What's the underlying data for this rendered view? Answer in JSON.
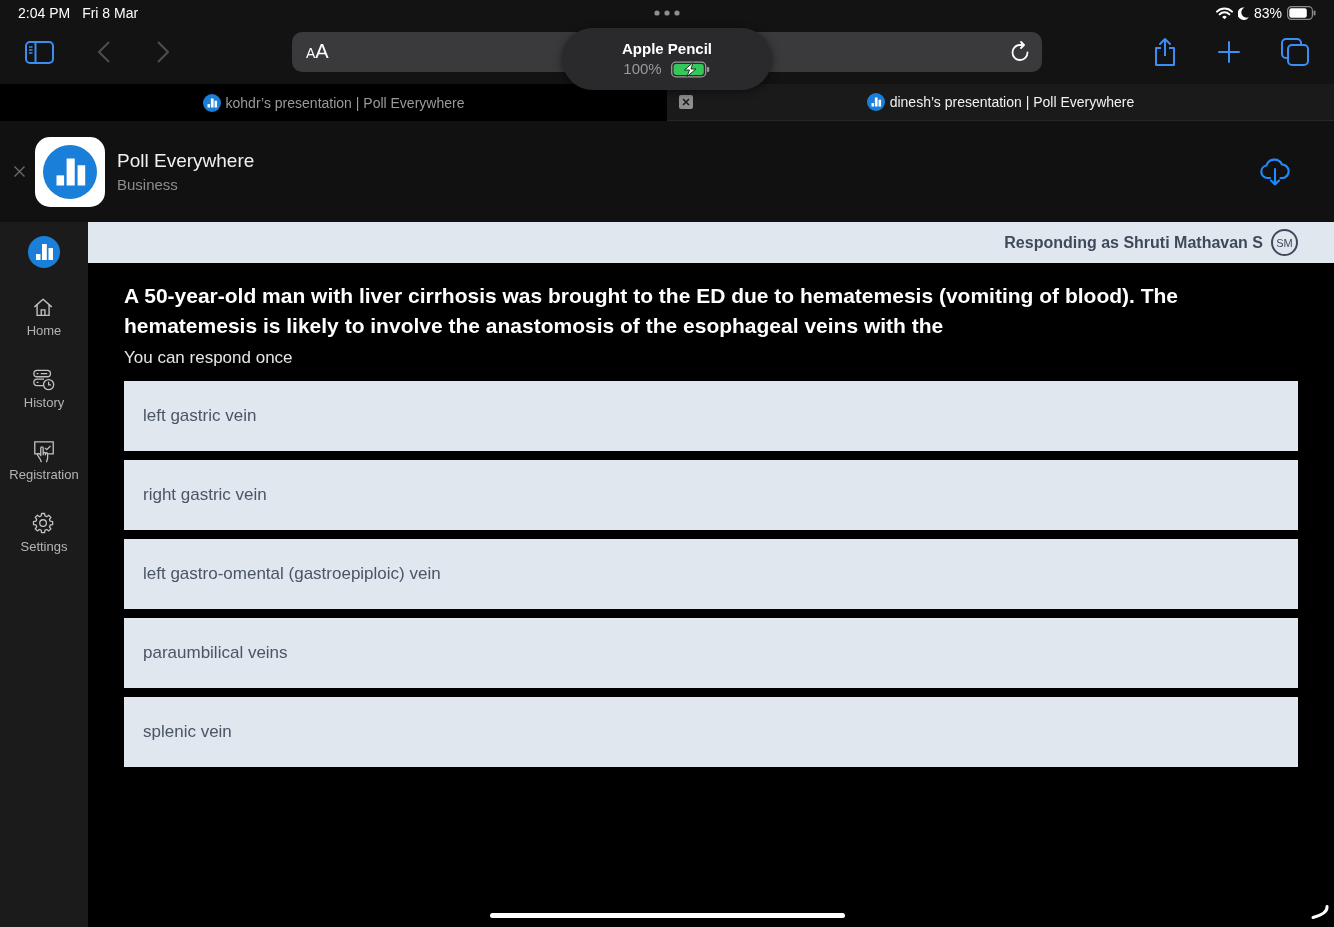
{
  "status_bar": {
    "time": "2:04 PM",
    "date": "Fri 8 Mar",
    "battery": "83%"
  },
  "browser_toolbar": {
    "reader_button": "AA"
  },
  "pencil_popup": {
    "title": "Apple Pencil",
    "battery": "100%",
    "charging": true
  },
  "tabs": [
    {
      "title": "kohdr’s presentation | Poll Everywhere",
      "selected": false
    },
    {
      "title": "dinesh’s presentation | Poll Everywhere",
      "selected": true
    }
  ],
  "app_banner": {
    "name": "Poll Everywhere",
    "category": "Business"
  },
  "sidebar": {
    "items": [
      {
        "kind": "home",
        "label": "Home",
        "selected": false
      },
      {
        "kind": "history",
        "label": "History",
        "selected": false
      },
      {
        "kind": "registration",
        "label": "Registration",
        "selected": false
      },
      {
        "kind": "settings",
        "label": "Settings",
        "selected": false
      }
    ]
  },
  "response_bar": {
    "text": "Responding as Shruti Mathavan S",
    "initials": "SM"
  },
  "question": {
    "text": "A 50-year-old man with liver cirrhosis was brought to the ED due to hematemesis (vomiting of blood). The hematemesis is likely to involve the anastomosis of the esophageal veins with the",
    "note": "You can respond once",
    "options": [
      {
        "label": "left gastric vein",
        "selected": false
      },
      {
        "label": "right gastric vein",
        "selected": false
      },
      {
        "label": "left gastro-omental (gastroepiploic) vein",
        "selected": false
      },
      {
        "label": "paraumbilical veins",
        "selected": false
      },
      {
        "label": "splenic vein",
        "selected": false
      }
    ]
  }
}
